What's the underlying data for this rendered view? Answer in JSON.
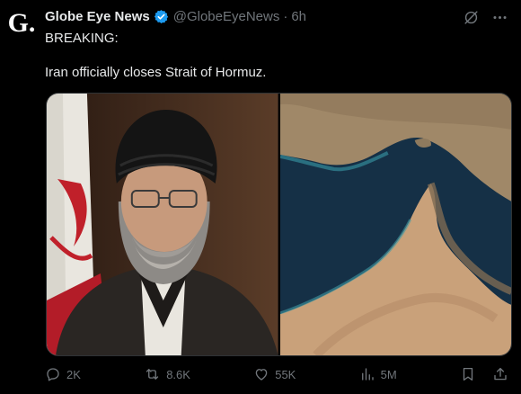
{
  "author": {
    "avatar_letter": "G.",
    "display_name": "Globe Eye News",
    "handle": "@GlobeEyeNews",
    "separator": "·",
    "time": "6h",
    "verified_color": "#1d9bf0"
  },
  "post": {
    "line1": "BREAKING:",
    "line2": "Iran officially closes Strait of Hormuz."
  },
  "media": {
    "left_icon": "portrait-photo",
    "right_icon": "satellite-map-photo"
  },
  "actions": {
    "replies": "2K",
    "reposts": "8.6K",
    "likes": "55K",
    "views": "5M"
  }
}
